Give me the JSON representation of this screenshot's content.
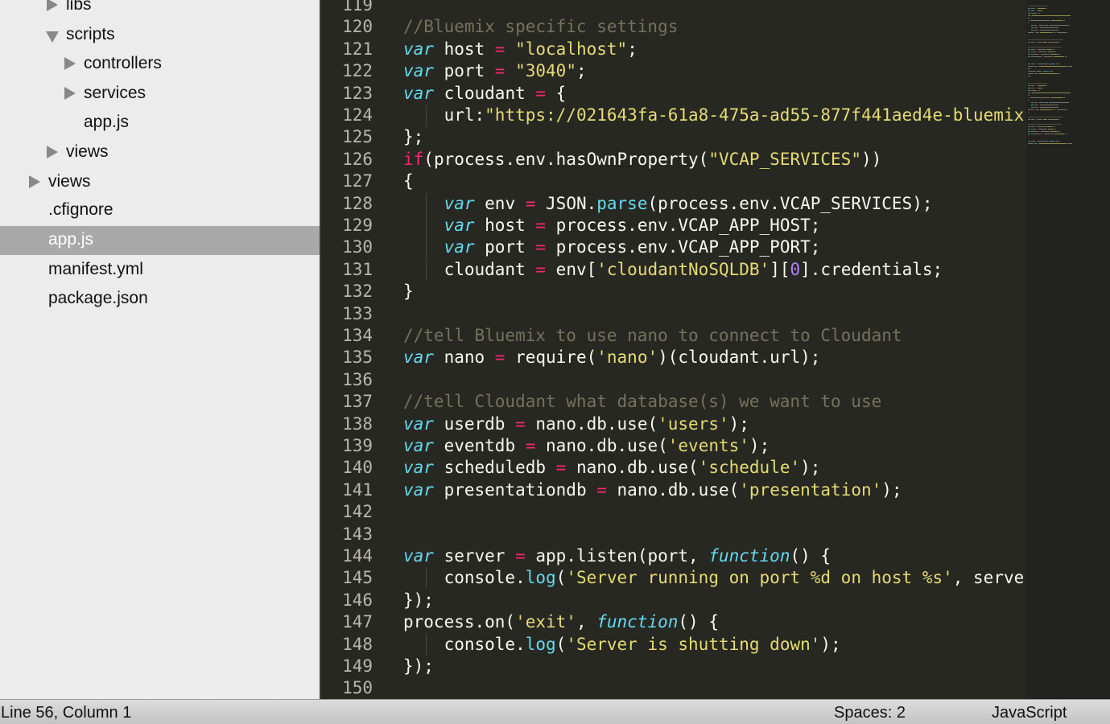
{
  "sidebar": {
    "items": [
      {
        "label": "libs"
      },
      {
        "label": "scripts"
      },
      {
        "label": "controllers"
      },
      {
        "label": "services"
      },
      {
        "label": "app.js"
      },
      {
        "label": "views"
      },
      {
        "label": "views"
      },
      {
        "label": ".cfignore"
      },
      {
        "label": "app.js"
      },
      {
        "label": "manifest.yml"
      },
      {
        "label": "package.json"
      }
    ]
  },
  "editor": {
    "language": "JavaScript",
    "colors": {
      "background": "#272822",
      "keyword": "#66d9ef",
      "string": "#e6db74",
      "comment": "#75715e",
      "operator": "#f92672",
      "number": "#ae81ff"
    },
    "lines": [
      {
        "n": "119",
        "tokens": []
      },
      {
        "n": "120",
        "tokens": [
          [
            "c",
            "//Bluemix specific settings"
          ]
        ]
      },
      {
        "n": "121",
        "tokens": [
          [
            "k",
            "var"
          ],
          [
            "t",
            " host "
          ],
          [
            "o",
            "="
          ],
          [
            "t",
            " "
          ],
          [
            "s",
            "\"localhost\""
          ],
          [
            "t",
            ";"
          ]
        ]
      },
      {
        "n": "122",
        "tokens": [
          [
            "k",
            "var"
          ],
          [
            "t",
            " port "
          ],
          [
            "o",
            "="
          ],
          [
            "t",
            " "
          ],
          [
            "s",
            "\"3040\""
          ],
          [
            "t",
            ";"
          ]
        ]
      },
      {
        "n": "123",
        "tokens": [
          [
            "k",
            "var"
          ],
          [
            "t",
            " cloudant "
          ],
          [
            "o",
            "="
          ],
          [
            "t",
            " {"
          ]
        ]
      },
      {
        "n": "124",
        "indent": true,
        "tokens": [
          [
            "t",
            "    url:"
          ],
          [
            "s",
            "\"https://021643fa-61a8-475a-ad55-877f441aed4e-bluemix"
          ]
        ]
      },
      {
        "n": "125",
        "tokens": [
          [
            "t",
            "};"
          ]
        ]
      },
      {
        "n": "126",
        "tokens": [
          [
            "x",
            "if"
          ],
          [
            "t",
            "(process.env.hasOwnProperty("
          ],
          [
            "s",
            "\"VCAP_SERVICES\""
          ],
          [
            "t",
            "))"
          ]
        ]
      },
      {
        "n": "127",
        "tokens": [
          [
            "t",
            "{"
          ]
        ]
      },
      {
        "n": "128",
        "indent": true,
        "tokens": [
          [
            "t",
            "    "
          ],
          [
            "k",
            "var"
          ],
          [
            "t",
            " env "
          ],
          [
            "o",
            "="
          ],
          [
            "t",
            " JSON."
          ],
          [
            "f",
            "parse"
          ],
          [
            "t",
            "(process.env.VCAP_SERVICES);"
          ]
        ]
      },
      {
        "n": "129",
        "indent": true,
        "tokens": [
          [
            "t",
            "    "
          ],
          [
            "k",
            "var"
          ],
          [
            "t",
            " host "
          ],
          [
            "o",
            "="
          ],
          [
            "t",
            " process.env.VCAP_APP_HOST;"
          ]
        ]
      },
      {
        "n": "130",
        "indent": true,
        "tokens": [
          [
            "t",
            "    "
          ],
          [
            "k",
            "var"
          ],
          [
            "t",
            " port "
          ],
          [
            "o",
            "="
          ],
          [
            "t",
            " process.env.VCAP_APP_PORT;"
          ]
        ]
      },
      {
        "n": "131",
        "indent": true,
        "tokens": [
          [
            "t",
            "    cloudant "
          ],
          [
            "o",
            "="
          ],
          [
            "t",
            " env["
          ],
          [
            "s",
            "'cloudantNoSQLDB'"
          ],
          [
            "t",
            "]["
          ],
          [
            "m",
            "0"
          ],
          [
            "t",
            "].credentials;"
          ]
        ]
      },
      {
        "n": "132",
        "tokens": [
          [
            "t",
            "}"
          ]
        ]
      },
      {
        "n": "133",
        "tokens": []
      },
      {
        "n": "134",
        "tokens": [
          [
            "c",
            "//tell Bluemix to use nano to connect to Cloudant"
          ]
        ]
      },
      {
        "n": "135",
        "tokens": [
          [
            "k",
            "var"
          ],
          [
            "t",
            " nano "
          ],
          [
            "o",
            "="
          ],
          [
            "t",
            " require("
          ],
          [
            "s",
            "'nano'"
          ],
          [
            "t",
            ")(cloudant.url);"
          ]
        ]
      },
      {
        "n": "136",
        "tokens": []
      },
      {
        "n": "137",
        "tokens": [
          [
            "c",
            "//tell Cloudant what database(s) we want to use"
          ]
        ]
      },
      {
        "n": "138",
        "tokens": [
          [
            "k",
            "var"
          ],
          [
            "t",
            " userdb "
          ],
          [
            "o",
            "="
          ],
          [
            "t",
            " nano.db.use("
          ],
          [
            "s",
            "'users'"
          ],
          [
            "t",
            ");"
          ]
        ]
      },
      {
        "n": "139",
        "tokens": [
          [
            "k",
            "var"
          ],
          [
            "t",
            " eventdb "
          ],
          [
            "o",
            "="
          ],
          [
            "t",
            " nano.db.use("
          ],
          [
            "s",
            "'events'"
          ],
          [
            "t",
            ");"
          ]
        ]
      },
      {
        "n": "140",
        "tokens": [
          [
            "k",
            "var"
          ],
          [
            "t",
            " scheduledb "
          ],
          [
            "o",
            "="
          ],
          [
            "t",
            " nano.db.use("
          ],
          [
            "s",
            "'schedule'"
          ],
          [
            "t",
            ");"
          ]
        ]
      },
      {
        "n": "141",
        "tokens": [
          [
            "k",
            "var"
          ],
          [
            "t",
            " presentationdb "
          ],
          [
            "o",
            "="
          ],
          [
            "t",
            " nano.db.use("
          ],
          [
            "s",
            "'presentation'"
          ],
          [
            "t",
            ");"
          ]
        ]
      },
      {
        "n": "142",
        "tokens": []
      },
      {
        "n": "143",
        "tokens": []
      },
      {
        "n": "144",
        "tokens": [
          [
            "k",
            "var"
          ],
          [
            "t",
            " server "
          ],
          [
            "o",
            "="
          ],
          [
            "t",
            " app.listen(port, "
          ],
          [
            "k",
            "function"
          ],
          [
            "t",
            "() {"
          ]
        ]
      },
      {
        "n": "145",
        "indent": true,
        "tokens": [
          [
            "t",
            "    console."
          ],
          [
            "f",
            "log"
          ],
          [
            "t",
            "("
          ],
          [
            "s",
            "'Server running on port %d on host %s'"
          ],
          [
            "t",
            ", serve"
          ]
        ]
      },
      {
        "n": "146",
        "tokens": [
          [
            "t",
            "});"
          ]
        ]
      },
      {
        "n": "147",
        "tokens": [
          [
            "t",
            "process.on("
          ],
          [
            "s",
            "'exit'"
          ],
          [
            "t",
            ", "
          ],
          [
            "k",
            "function"
          ],
          [
            "t",
            "() {"
          ]
        ]
      },
      {
        "n": "148",
        "indent": true,
        "tokens": [
          [
            "t",
            "    console."
          ],
          [
            "f",
            "log"
          ],
          [
            "t",
            "("
          ],
          [
            "s",
            "'Server is shutting down'"
          ],
          [
            "t",
            ");"
          ]
        ]
      },
      {
        "n": "149",
        "tokens": [
          [
            "t",
            "});"
          ]
        ]
      },
      {
        "n": "150",
        "tokens": []
      }
    ]
  },
  "statusbar": {
    "position": "Line 56, Column 1",
    "indentation": "Spaces: 2",
    "syntax": "JavaScript"
  }
}
